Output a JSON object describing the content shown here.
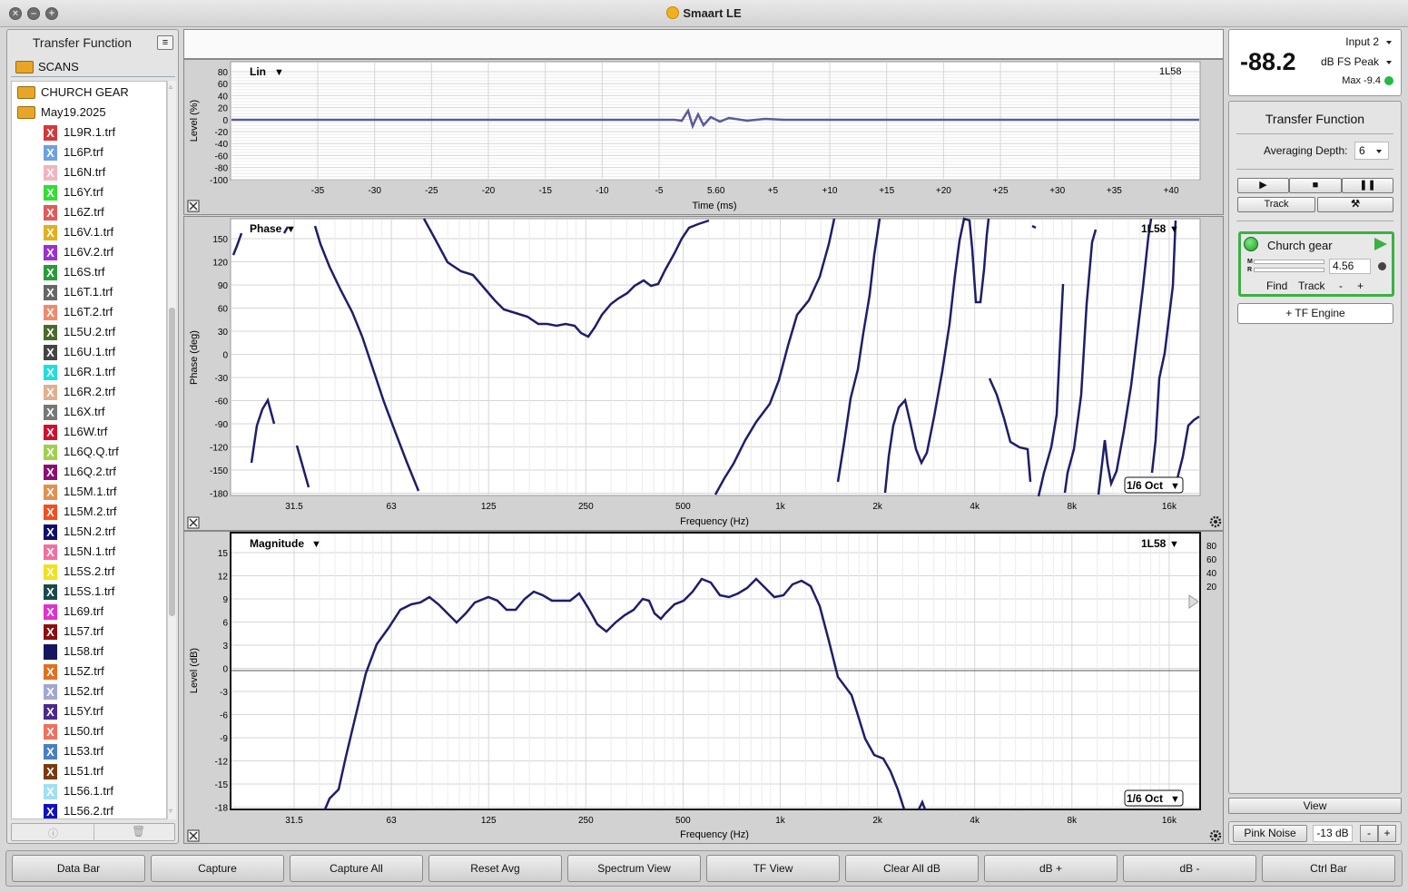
{
  "window": {
    "title": "Smaart LE"
  },
  "left_panel": {
    "title": "Transfer Function",
    "root_folder": "SCANS",
    "folders": [
      "CHURCH GEAR",
      "May19.2025"
    ],
    "files": [
      {
        "name": "1L9R.1.trf",
        "color": "#d23a3a"
      },
      {
        "name": "1L6P.trf",
        "color": "#6fa0e0"
      },
      {
        "name": "1L6N.trf",
        "color": "#f2b4c0"
      },
      {
        "name": "1L6Y.trf",
        "color": "#33dd33"
      },
      {
        "name": "1L6Z.trf",
        "color": "#e05a5a"
      },
      {
        "name": "1L6V.1.trf",
        "color": "#e0b020"
      },
      {
        "name": "1L6V.2.trf",
        "color": "#9a30d0"
      },
      {
        "name": "1L6S.trf",
        "color": "#2a9a3a"
      },
      {
        "name": "1L6T.1.trf",
        "color": "#666666"
      },
      {
        "name": "1L6T.2.trf",
        "color": "#ee8a70"
      },
      {
        "name": "1L5U.2.trf",
        "color": "#4a6a2a"
      },
      {
        "name": "1L6U.1.trf",
        "color": "#444444"
      },
      {
        "name": "1L6R.1.trf",
        "color": "#22dddd"
      },
      {
        "name": "1L6R.2.trf",
        "color": "#e0b090"
      },
      {
        "name": "1L6X.trf",
        "color": "#777777"
      },
      {
        "name": "1L6W.trf",
        "color": "#d01030"
      },
      {
        "name": "1L6Q.Q.trf",
        "color": "#a0d050"
      },
      {
        "name": "1L6Q.2.trf",
        "color": "#8a1070"
      },
      {
        "name": "1L5M.1.trf",
        "color": "#e09050"
      },
      {
        "name": "1L5M.2.trf",
        "color": "#f05020"
      },
      {
        "name": "1L5N.2.trf",
        "color": "#10106a"
      },
      {
        "name": "1L5N.1.trf",
        "color": "#f070a0"
      },
      {
        "name": "1L5S.2.trf",
        "color": "#f0e020"
      },
      {
        "name": "1L5S.1.trf",
        "color": "#1a4a4a"
      },
      {
        "name": "1L69.trf",
        "color": "#e030d0"
      },
      {
        "name": "1L57.trf",
        "color": "#8a1010"
      },
      {
        "name": "1L58.trf",
        "color": "#151560"
      },
      {
        "name": "1L5Z.trf",
        "color": "#e07020"
      },
      {
        "name": "1L52.trf",
        "color": "#a0a8d0"
      },
      {
        "name": "1L5Y.trf",
        "color": "#4a2a8a"
      },
      {
        "name": "1L50.trf",
        "color": "#f07060"
      },
      {
        "name": "1L53.trf",
        "color": "#4a80c0"
      },
      {
        "name": "1L51.trf",
        "color": "#7a3a10"
      },
      {
        "name": "1L56.1.trf",
        "color": "#a0e0f0"
      },
      {
        "name": "1L56.2.trf",
        "color": "#1010c0"
      }
    ]
  },
  "plots": {
    "impulse": {
      "mode_label": "Lin",
      "trace_label": "1L58",
      "ylabel": "Level (%)",
      "xlabel": "Time (ms)",
      "yticks": [
        "80",
        "60",
        "40",
        "20",
        "0",
        "-20",
        "-40",
        "-60",
        "-80",
        "-100"
      ],
      "xticks": [
        "-35",
        "-30",
        "-25",
        "-20",
        "-15",
        "-10",
        "-5",
        "5.60",
        "+5",
        "+10",
        "+15",
        "+20",
        "+25",
        "+30",
        "+35",
        "+40"
      ]
    },
    "phase": {
      "mode_label": "Phase",
      "trace_label": "1L58",
      "ylabel": "Phase (deg)",
      "xlabel": "Frequency (Hz)",
      "smoothing": "1/6 Oct",
      "yticks": [
        "150",
        "120",
        "90",
        "60",
        "30",
        "0",
        "-30",
        "-60",
        "-90",
        "-120",
        "-150",
        "-180"
      ],
      "xticks": [
        "31.5",
        "63",
        "125",
        "250",
        "500",
        "1k",
        "2k",
        "4k",
        "8k",
        "16k"
      ]
    },
    "magnitude": {
      "mode_label": "Magnitude",
      "trace_label": "1L58",
      "ylabel": "Level (dB)",
      "xlabel": "Frequency (Hz)",
      "smoothing": "1/6 Oct",
      "yticks": [
        "15",
        "12",
        "9",
        "6",
        "3",
        "0",
        "-3",
        "-6",
        "-9",
        "-12",
        "-15",
        "-18"
      ],
      "xticks": [
        "31.5",
        "63",
        "125",
        "250",
        "500",
        "1k",
        "2k",
        "4k",
        "8k",
        "16k"
      ],
      "coherence_ticks": [
        "80",
        "60",
        "40",
        "20"
      ]
    }
  },
  "meter": {
    "value": "-88.2",
    "input": "Input 2",
    "units": "dB FS Peak",
    "max": "Max -9.4",
    "status_color": "#22bb44"
  },
  "tf_panel": {
    "title": "Transfer Function",
    "averaging_label": "Averaging Depth:",
    "averaging_value": "6",
    "track_label": "Track",
    "engine": {
      "name": "Church gear",
      "delay": "4.56",
      "m_label": "M",
      "r_label": "R",
      "find": "Find",
      "track": "Track",
      "minus": "-",
      "plus": "+"
    },
    "add_engine": "+ TF Engine",
    "view": "View"
  },
  "generator": {
    "label": "Pink Noise",
    "level": "-13 dB",
    "minus": "-",
    "plus": "+"
  },
  "bottom_buttons": [
    "Data Bar",
    "Capture",
    "Capture All",
    "Reset Avg",
    "Spectrum View",
    "TF View",
    "Clear All dB",
    "dB +",
    "dB -",
    "Ctrl Bar"
  ]
}
